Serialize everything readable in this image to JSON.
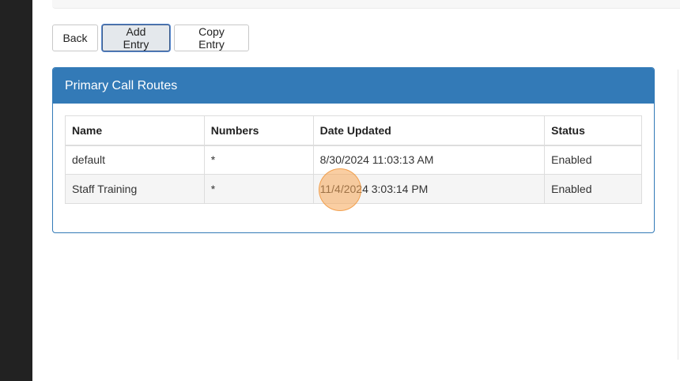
{
  "toolbar": {
    "back_label": "Back",
    "add_label": "Add Entry",
    "copy_label": "Copy Entry"
  },
  "panel": {
    "title": "Primary Call Routes",
    "columns": [
      "Name",
      "Numbers",
      "Date Updated",
      "Status"
    ],
    "rows": [
      {
        "name": "default",
        "numbers": "*",
        "date_updated": "8/30/2024 11:03:13 AM",
        "status": "Enabled"
      },
      {
        "name": "Staff Training",
        "numbers": "*",
        "date_updated": "11/4/2024 3:03:14 PM",
        "status": "Enabled"
      }
    ]
  },
  "colors": {
    "panel_primary": "#337ab7",
    "left_rail": "#222222",
    "click_marker": "#f6a656"
  }
}
